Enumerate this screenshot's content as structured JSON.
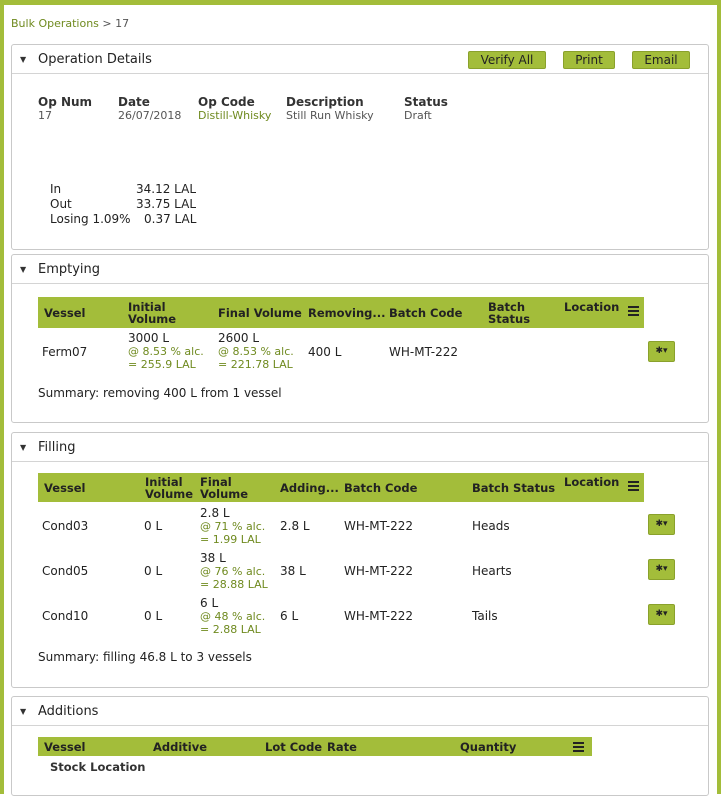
{
  "breadcrumb": {
    "parent": "Bulk Operations",
    "separator": " > ",
    "current": "17"
  },
  "operation": {
    "title": "Operation Details",
    "buttons": {
      "verify": "Verify All",
      "print": "Print",
      "email": "Email"
    },
    "fields": [
      {
        "label": "Op Num",
        "value": "17"
      },
      {
        "label": "Date",
        "value": "26/07/2018"
      },
      {
        "label": "Op Code",
        "value": "Distill-Whisky"
      },
      {
        "label": "Description",
        "value": "Still Run Whisky"
      },
      {
        "label": "Status",
        "value": "Draft"
      }
    ],
    "totals": [
      {
        "label": "In",
        "value": "34.12 LAL"
      },
      {
        "label": "Out",
        "value": "33.75 LAL"
      },
      {
        "label": "Losing 1.09%",
        "value": "0.37 LAL"
      }
    ]
  },
  "emptying": {
    "title": "Emptying",
    "columns": [
      "Vessel",
      "Initial Volume",
      "Final Volume",
      "Removing...",
      "Batch Code",
      "Batch Status",
      "Location"
    ],
    "rows": [
      {
        "vessel": "Ferm07",
        "initial": "3000 L",
        "initial_abv": "@ 8.53 % alc.",
        "initial_lal": "= 255.9 LAL",
        "final": "2600 L",
        "final_abv": "@ 8.53 % alc.",
        "final_lal": "= 221.78 LAL",
        "removing": "400 L",
        "batch_code": "WH-MT-222"
      }
    ],
    "summary": "Summary: removing 400 L from 1 vessel"
  },
  "filling": {
    "title": "Filling",
    "columns": [
      "Vessel",
      "Initial Volume",
      "Final Volume",
      "Adding...",
      "Batch Code",
      "Batch Status",
      "Location"
    ],
    "rows": [
      {
        "vessel": "Cond03",
        "initial": "0 L",
        "final": "2.8 L",
        "final_abv": "@ 71 % alc.",
        "final_lal": "= 1.99 LAL",
        "adding": "2.8 L",
        "batch_code": "WH-MT-222",
        "batch_status": "Heads"
      },
      {
        "vessel": "Cond05",
        "initial": "0 L",
        "final": "38 L",
        "final_abv": "@ 76 % alc.",
        "final_lal": "= 28.88 LAL",
        "adding": "38 L",
        "batch_code": "WH-MT-222",
        "batch_status": "Hearts"
      },
      {
        "vessel": "Cond10",
        "initial": "0 L",
        "final": "6 L",
        "final_abv": "@ 48 % alc.",
        "final_lal": "= 2.88 LAL",
        "adding": "6 L",
        "batch_code": "WH-MT-222",
        "batch_status": "Tails"
      }
    ],
    "summary": "Summary: filling 46.8 L to 3 vessels"
  },
  "additions": {
    "title": "Additions",
    "columns": [
      "Vessel",
      "Additive",
      "Lot Code",
      "Rate",
      "Quantity"
    ],
    "subheader": "Stock Location"
  },
  "icons": {
    "caret": "caret-down-icon",
    "menu": "menu-icon",
    "gear": "gear-icon"
  },
  "colors": {
    "accent": "#a3bd3a",
    "link": "#6f8a1f"
  }
}
